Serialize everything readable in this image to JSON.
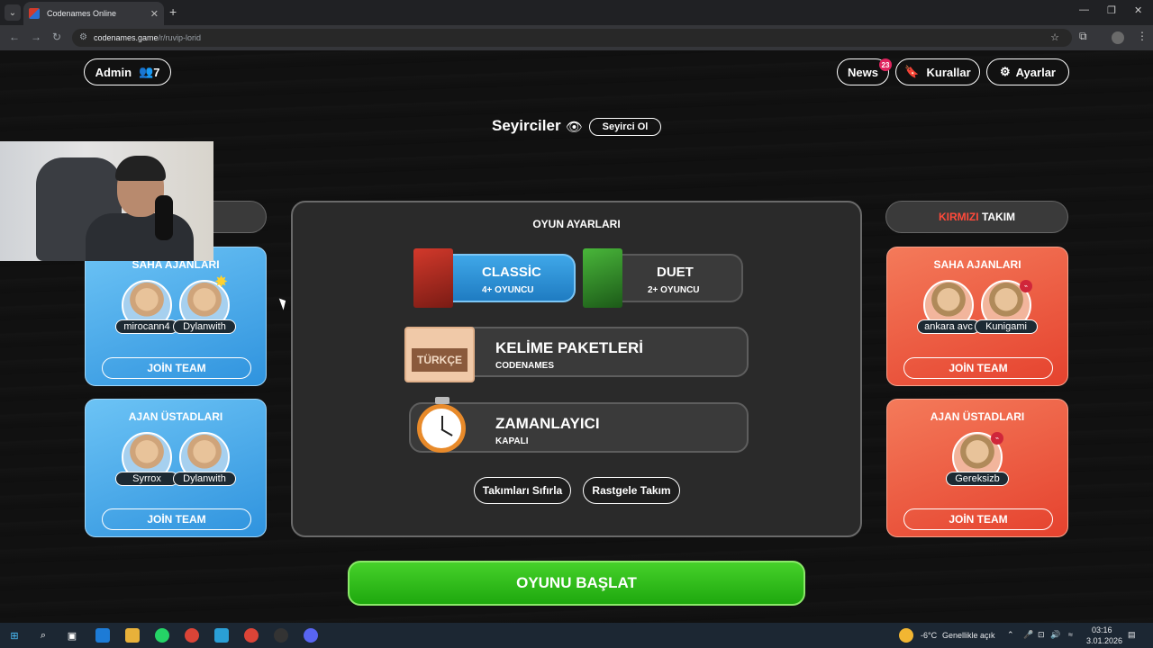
{
  "browser": {
    "tab_title": "Codenames Online",
    "url_host": "codenames.game",
    "url_path": "/r/ruvip-lorid"
  },
  "header": {
    "admin_label": "Admin",
    "player_count": "7",
    "news_label": "News",
    "news_badge": "23",
    "rules_label": "Kurallar",
    "settings_label": "Ayarlar"
  },
  "spectators": {
    "title": "Seyirciler",
    "button": "Seyirci Ol"
  },
  "blue_team": {
    "field_agents": {
      "title": "SAHA AJANLARI",
      "players": [
        "mirocann4",
        "Dylanwith"
      ],
      "join": "JOİN TEAM"
    },
    "spymasters": {
      "title": "AJAN ÜSTADLARI",
      "players": [
        "Syrrox",
        "Dylanwith"
      ],
      "join": "JOİN TEAM"
    }
  },
  "red_team": {
    "header_colored": "KIRMIZI",
    "header_rest": "TAKIM",
    "field_agents": {
      "title": "SAHA AJANLARI",
      "players": [
        "ankara avc",
        "Kunigami"
      ],
      "join": "JOİN TEAM"
    },
    "spymasters": {
      "title": "AJAN ÜSTADLARI",
      "players": [
        "Gereksizb"
      ],
      "join": "JOİN TEAM"
    }
  },
  "settings": {
    "title": "OYUN AYARLARI",
    "modes": [
      {
        "name": "CLASSİC",
        "sub": "4+ OYUNCU"
      },
      {
        "name": "DUET",
        "sub": "2+ OYUNCU"
      }
    ],
    "word_packs": {
      "title": "KELİME PAKETLERİ",
      "sub": "CODENAMES",
      "card": "TÜRKÇE"
    },
    "timer": {
      "title": "ZAMANLAYICI",
      "sub": "KAPALI"
    },
    "reset_teams": "Takımları Sıfırla",
    "random_team": "Rastgele Takım"
  },
  "start_button": "OYUNU BAŞLAT",
  "taskbar": {
    "temperature": "-6°C",
    "weather": "Genellikle açık",
    "time": "03:16",
    "date": "3.01.2026"
  },
  "colors": {
    "blue": "#2f93de",
    "red": "#e5422e",
    "green": "#1ea80e",
    "red_text": "#ff4a3a"
  }
}
